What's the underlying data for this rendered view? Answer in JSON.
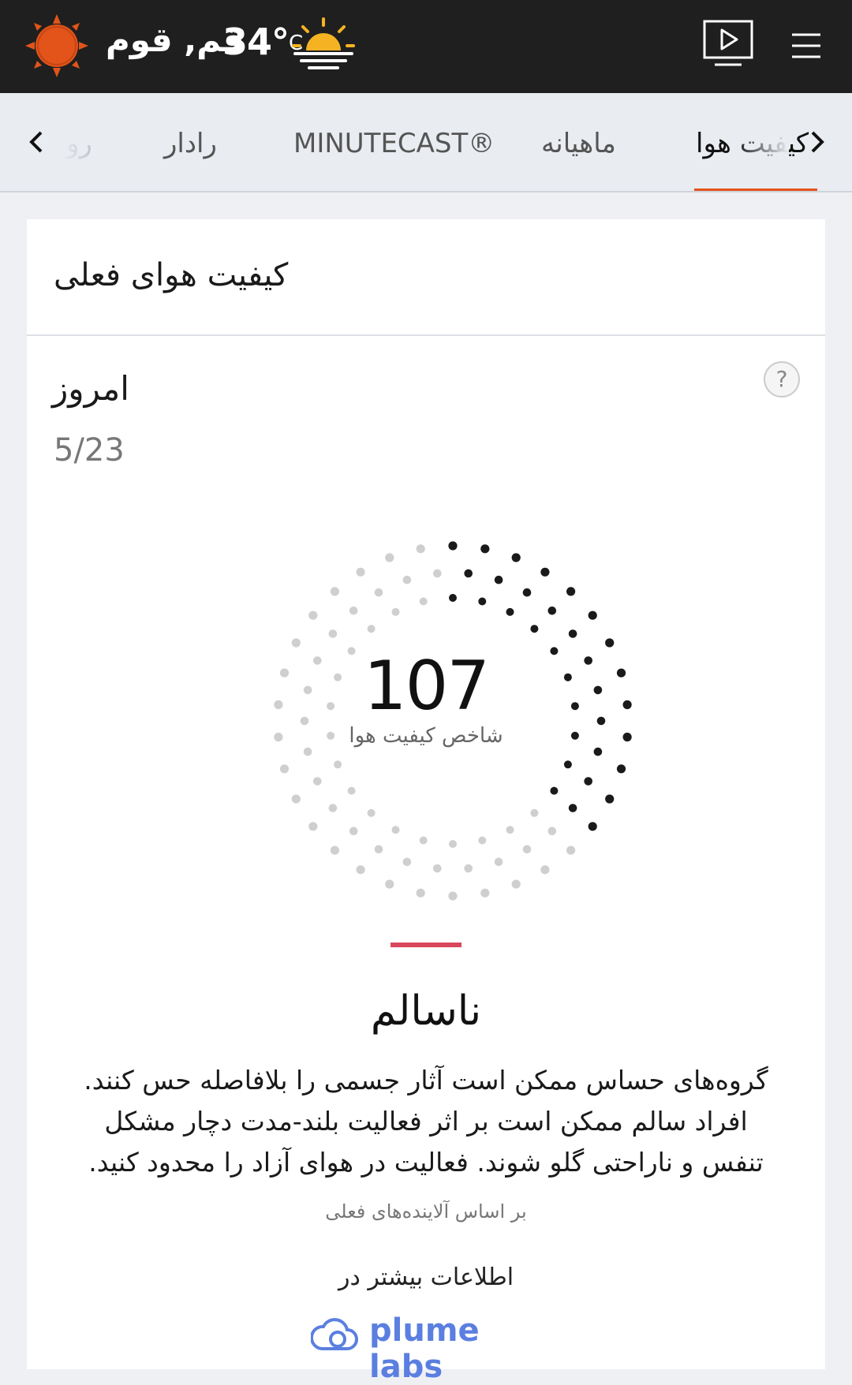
{
  "header": {
    "location": "قم, قوم",
    "temperature": "34°",
    "temp_unit": "C",
    "logo_icon": "sun-logo-icon",
    "weather_icon": "sunset-icon",
    "video_icon": "video-play-icon",
    "menu_icon": "hamburger-menu-icon",
    "accent_color": "#e2541a"
  },
  "tabs": {
    "items": [
      {
        "label": "کیفیت هوا",
        "active": true
      },
      {
        "label": "ماهیانه"
      },
      {
        "label": "MINUTECAST®"
      },
      {
        "label": "رادار"
      },
      {
        "label": "رو"
      }
    ]
  },
  "card": {
    "title": "کیفیت هوای فعلی",
    "day": "امروز",
    "date": "5/23",
    "help": "?",
    "aqi_value": "107",
    "aqi_fraction": 0.36,
    "aqi_label": "شاخص کیفیت هوا",
    "category": "ناسالم",
    "category_color": "#d9475c",
    "description": "گروه‌های حساس ممکن است آثار جسمی را بلافاصله حس کنند. افراد سالم ممکن است بر اثر فعالیت بلند-مدت دچار مشکل تنفس و ناراحتی گلو شوند. فعالیت در هوای آزاد را محدود کنید.",
    "basis": "بر اساس آلاینده‌های فعلی",
    "more_info": "اطلاعات بیشتر در",
    "provider": "plume labs",
    "provider_color": "#5b7fe0"
  }
}
